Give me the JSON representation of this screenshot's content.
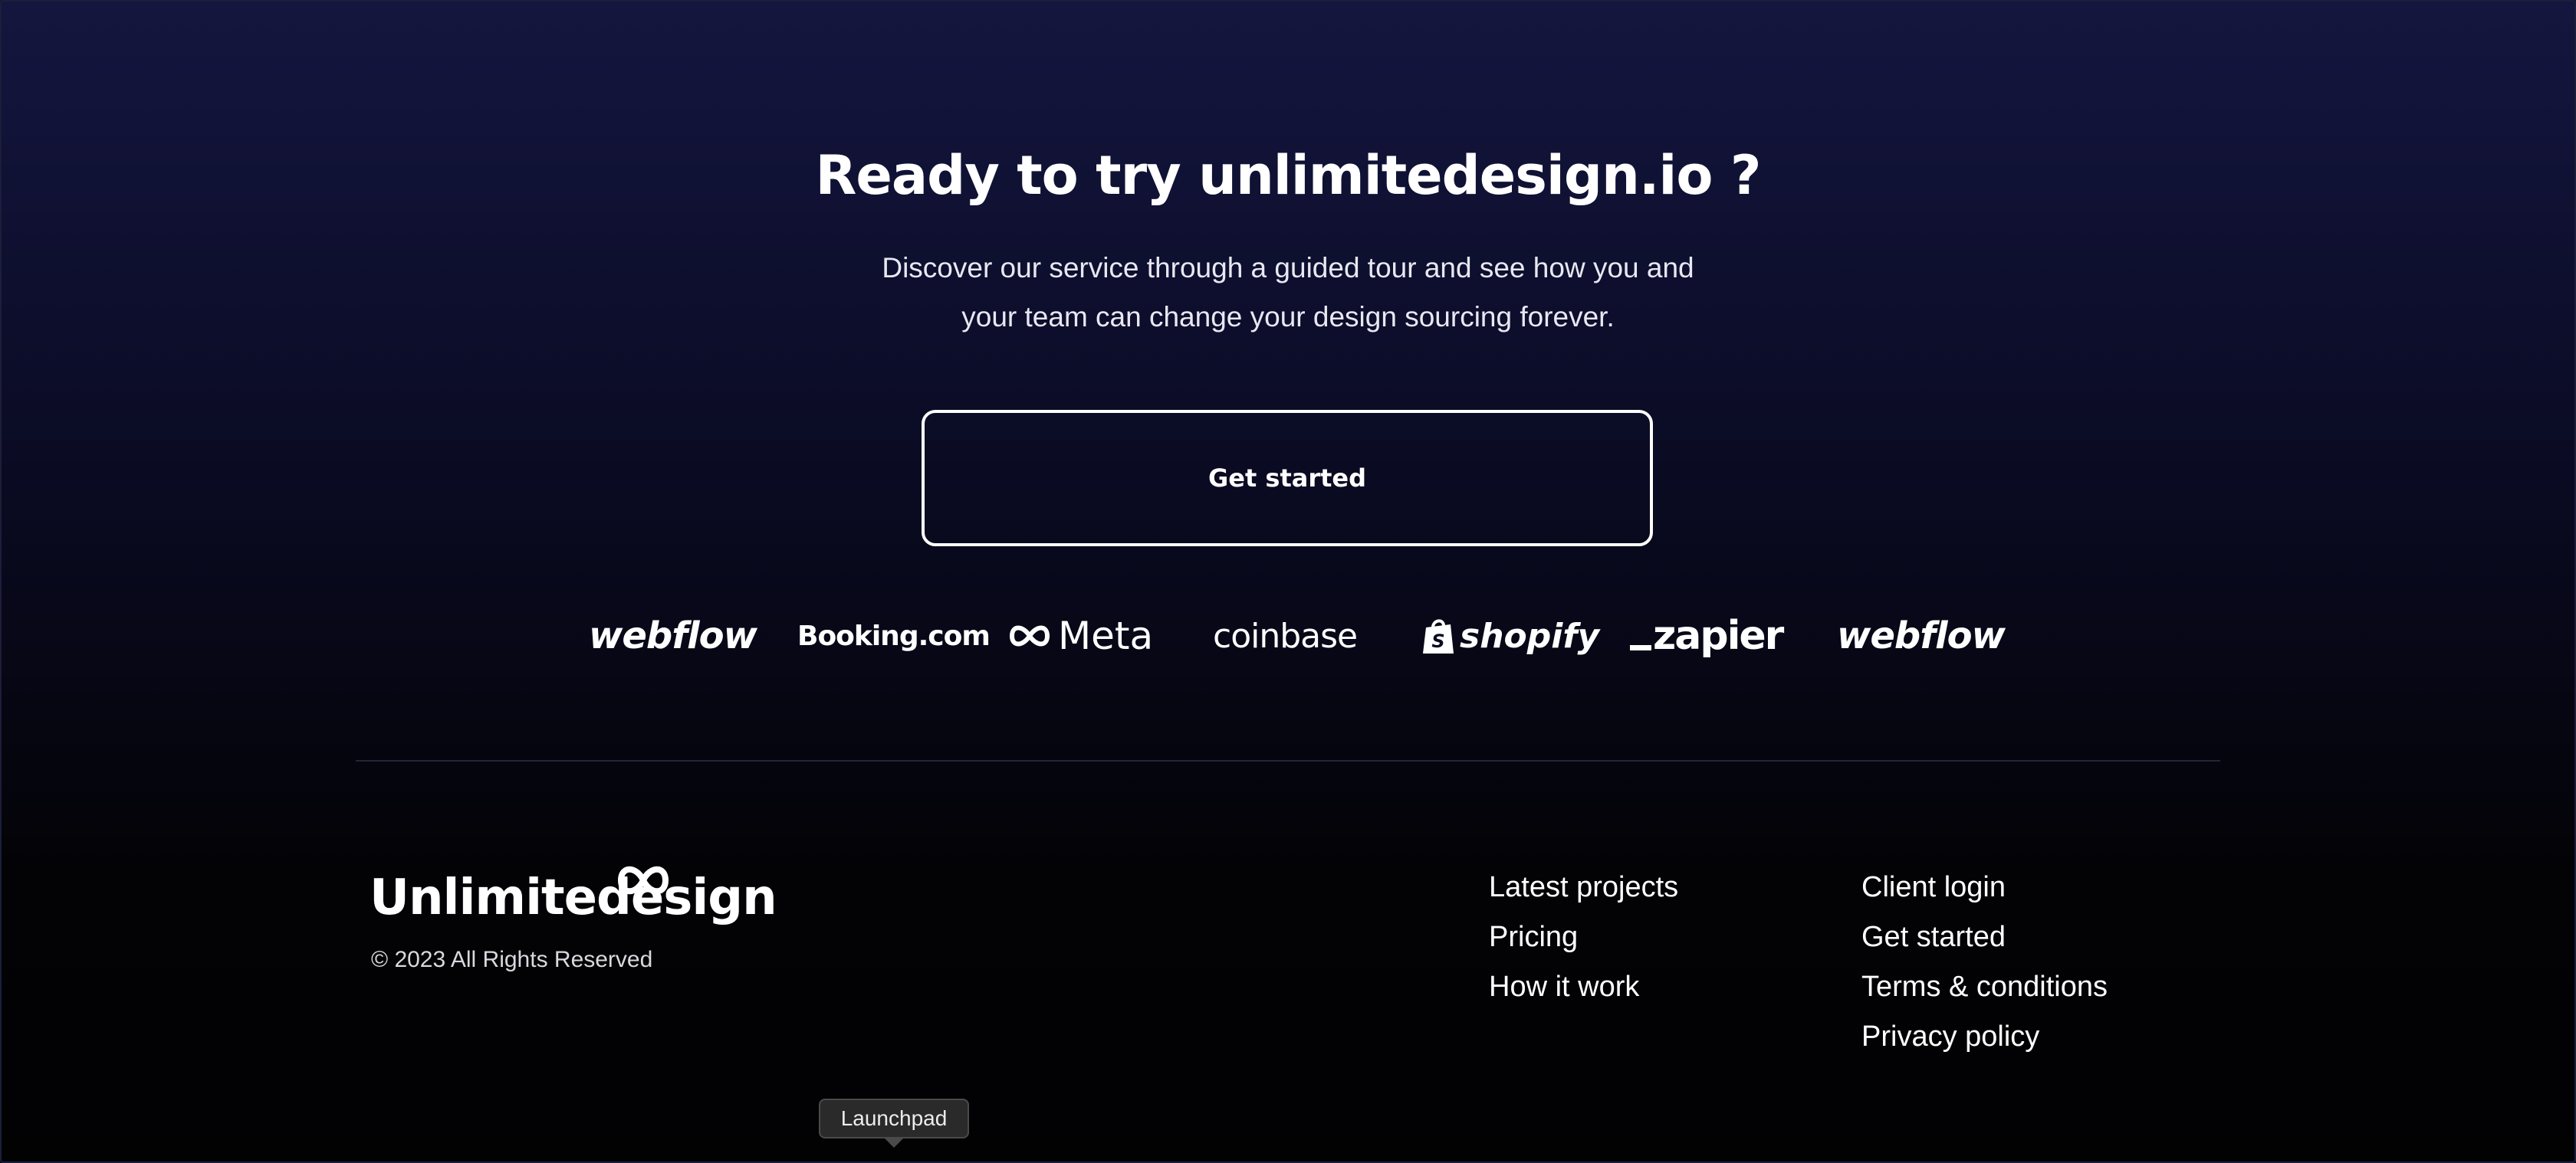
{
  "hero": {
    "title": "Ready to try unlimitedesign.io ?",
    "description": "Discover our service through a guided tour and see how you and your team can change your design sourcing forever.",
    "cta_label": "Get started"
  },
  "client_logos": [
    {
      "name": "webflow",
      "text": "webflow"
    },
    {
      "name": "booking",
      "text": "Booking.com"
    },
    {
      "name": "meta",
      "text": "Meta"
    },
    {
      "name": "coinbase",
      "text": "coinbase"
    },
    {
      "name": "shopify",
      "text": "shopify"
    },
    {
      "name": "zapier",
      "text": "zapier"
    },
    {
      "name": "webflow",
      "text": "webflow"
    }
  ],
  "footer": {
    "brand": "Unlimitedesign",
    "copyright": "© 2023 All Rights Reserved",
    "links_col1": [
      "Latest projects",
      "Pricing",
      "How it work"
    ],
    "links_col2": [
      "Client login",
      "Get started",
      "Terms & conditions",
      "Privacy policy"
    ]
  },
  "tooltip": {
    "label": "Launchpad"
  },
  "colors": {
    "background_top": "#14163f",
    "background_bottom": "#020203",
    "text": "#ffffff"
  }
}
